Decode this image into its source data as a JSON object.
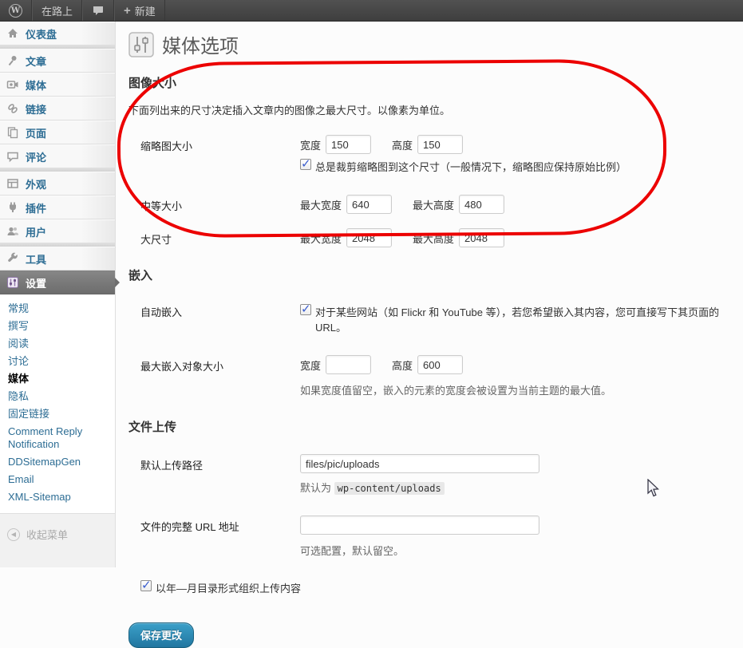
{
  "admin_bar": {
    "wp_logo": "W",
    "site_name": "在路上",
    "comments_icon": "comment-bubble-icon",
    "plus": "+",
    "new_label": "新建"
  },
  "sidebar": {
    "items": [
      {
        "label": "仪表盘",
        "icon": "dashboard-icon"
      },
      {
        "label": "文章",
        "icon": "posts-pushpin-icon"
      },
      {
        "label": "媒体",
        "icon": "media-camera-icon"
      },
      {
        "label": "链接",
        "icon": "links-chain-icon"
      },
      {
        "label": "页面",
        "icon": "pages-icon"
      },
      {
        "label": "评论",
        "icon": "comments-bubble-icon"
      },
      {
        "label": "外观",
        "icon": "appearance-icon"
      },
      {
        "label": "插件",
        "icon": "plugins-plug-icon"
      },
      {
        "label": "用户",
        "icon": "users-icon"
      },
      {
        "label": "工具",
        "icon": "tools-wrench-icon"
      },
      {
        "label": "设置",
        "icon": "settings-sliders-icon"
      }
    ],
    "submenu": {
      "general": "常规",
      "writing": "撰写",
      "reading": "阅读",
      "discussion": "讨论",
      "media": "媒体",
      "privacy": "隐私",
      "permalinks": "固定链接",
      "comment_reply": "Comment Reply Notification",
      "ddsitemap": "DDSitemapGen",
      "email": "Email",
      "xml_sitemap": "XML-Sitemap"
    },
    "collapse_label": "收起菜单"
  },
  "page": {
    "title": "媒体选项",
    "image_size": {
      "heading": "图像大小",
      "description": "下面列出来的尺寸决定插入文章内的图像之最大尺寸。以像素为单位。",
      "thumbnail": {
        "label": "缩略图大小",
        "width_label": "宽度",
        "width_value": "150",
        "height_label": "高度",
        "height_value": "150",
        "crop_checked": true,
        "crop_label": "总是裁剪缩略图到这个尺寸（一般情况下，缩略图应保持原始比例）"
      },
      "medium": {
        "label": "中等大小",
        "width_label": "最大宽度",
        "width_value": "640",
        "height_label": "最大高度",
        "height_value": "480"
      },
      "large": {
        "label": "大尺寸",
        "width_label": "最大宽度",
        "width_value": "2048",
        "height_label": "最大高度",
        "height_value": "2048"
      }
    },
    "embed": {
      "heading": "嵌入",
      "auto": {
        "label": "自动嵌入",
        "checked": true,
        "text": "对于某些网站（如 Flickr 和 YouTube 等），若您希望嵌入其内容，您可直接写下其页面的 URL。"
      },
      "max": {
        "label": "最大嵌入对象大小",
        "width_label": "宽度",
        "width_value": "",
        "height_label": "高度",
        "height_value": "600",
        "description": "如果宽度值留空，嵌入的元素的宽度会被设置为当前主题的最大值。"
      }
    },
    "upload": {
      "heading": "文件上传",
      "path": {
        "label": "默认上传路径",
        "value": "files/pic/uploads",
        "default_prefix": "默认为",
        "default_code": "wp-content/uploads"
      },
      "url": {
        "label": "文件的完整 URL 地址",
        "value": "",
        "description": "可选配置，默认留空。"
      },
      "organize": {
        "checked": true,
        "label": "以年—月目录形式组织上传内容"
      },
      "save_label": "保存更改"
    }
  },
  "colors": {
    "annotation_red": "#ec0000",
    "button_blue": "#2176a0",
    "menu_link_blue": "#2d6d94",
    "adminbar_gray": "#464646"
  }
}
